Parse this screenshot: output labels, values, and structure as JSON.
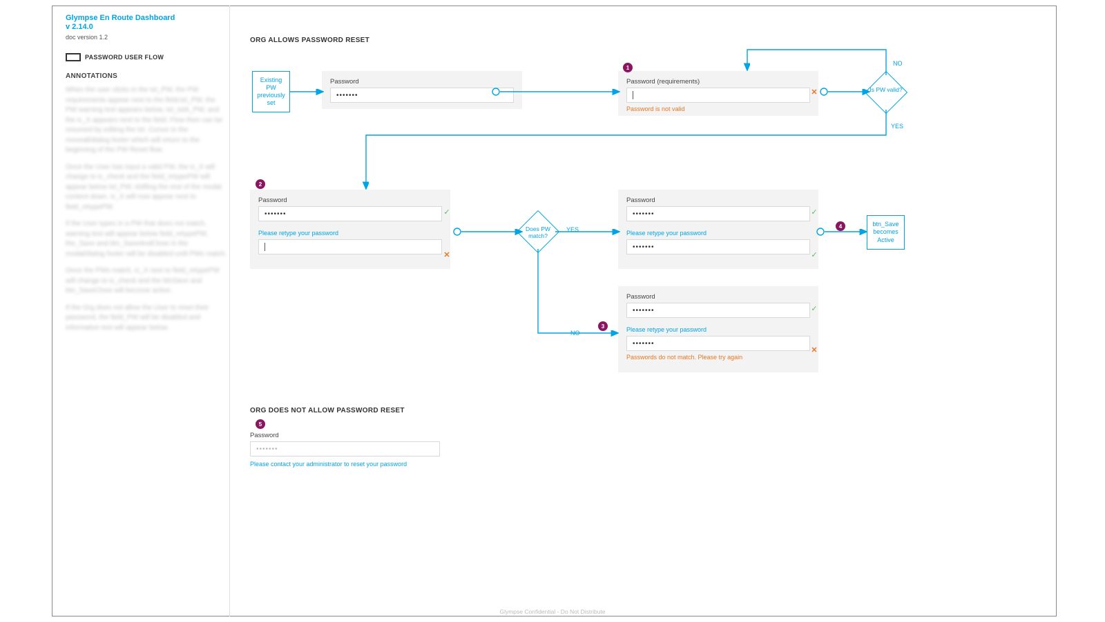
{
  "sidebar": {
    "product_title": "Glympse En Route Dashboard",
    "product_version": "v 2.14.0",
    "doc_version": "doc version 1.2",
    "legend_label": "PASSWORD USER FLOW",
    "annotations_heading": "ANNOTATIONS"
  },
  "sections": {
    "allow_title": "ORG ALLOWS PASSWORD RESET",
    "deny_title": "ORG DOES NOT ALLOW PASSWORD RESET"
  },
  "nodes": {
    "existing": "Existing PW previously set",
    "is_valid": "Is PW valid?",
    "match": "Does PW match?",
    "save_active": "btn_Save becomes Active"
  },
  "labels": {
    "no": "NO",
    "yes": "YES"
  },
  "cards": {
    "pw_plain_label": "Password",
    "pw_req_label": "Password (requirements)",
    "mask": "•••••••",
    "retype": "Please retype your password",
    "err_invalid": "Password is not valid",
    "err_mismatch": "Passwords do not match. Please try again",
    "contact_admin": "Please contact your administrator to reset your password"
  },
  "nums": {
    "n1": "1",
    "n2": "2",
    "n3": "3",
    "n4": "4",
    "n5": "5"
  },
  "footer": "Glympse Confidential - Do Not Distribute"
}
